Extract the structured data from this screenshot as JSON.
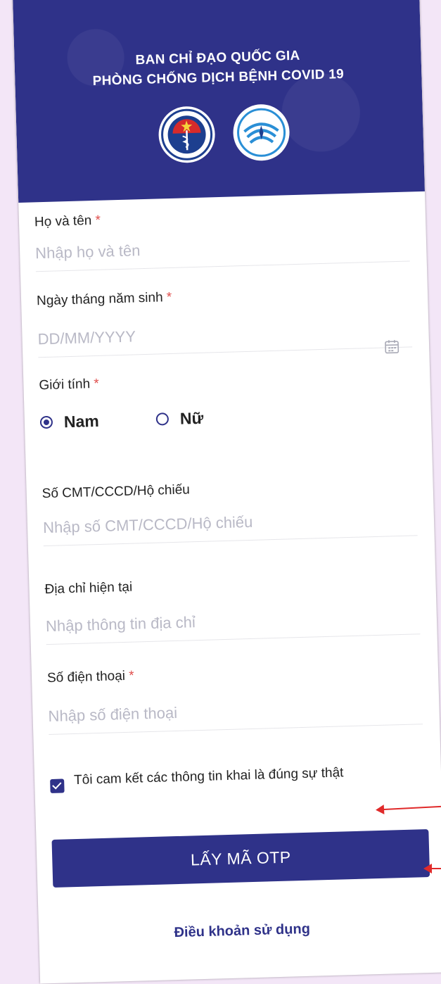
{
  "header": {
    "line1": "BAN CHỈ ĐẠO QUỐC GIA",
    "line2": "PHÒNG CHỐNG DỊCH BỆNH COVID 19",
    "logos": [
      "ministry-of-health-logo",
      "ministry-of-information-logo"
    ]
  },
  "form": {
    "name": {
      "label": "Họ và tên",
      "required": "*",
      "placeholder": "Nhập họ và tên",
      "value": ""
    },
    "dob": {
      "label": "Ngày tháng năm sinh",
      "required": "*",
      "placeholder": "DD/MM/YYYY",
      "value": "",
      "icon": "calendar-icon"
    },
    "gender": {
      "label": "Giới tính",
      "required": "*",
      "options": [
        "Nam",
        "Nữ"
      ],
      "selected": "Nam"
    },
    "id_number": {
      "label": "Số CMT/CCCD/Hộ chiếu",
      "placeholder": "Nhập số CMT/CCCD/Hộ chiếu",
      "value": ""
    },
    "address": {
      "label": "Địa chỉ hiện tại",
      "placeholder": "Nhập thông tin địa chỉ",
      "value": ""
    },
    "phone": {
      "label": "Số điện thoại",
      "required": "*",
      "placeholder": "Nhập số điện thoại",
      "value": ""
    },
    "commitment": {
      "text": "Tôi cam kết các thông tin khai là đúng sự thật",
      "checked": true
    }
  },
  "otp_button": {
    "label": "LẤY MÃ OTP"
  },
  "terms_link": {
    "label": "Điều khoản sử dụng"
  },
  "colors": {
    "primary": "#2f3289",
    "required_star": "#e0504e",
    "annotation_arrow": "#e02a2a",
    "background": "#f3e6f7"
  }
}
